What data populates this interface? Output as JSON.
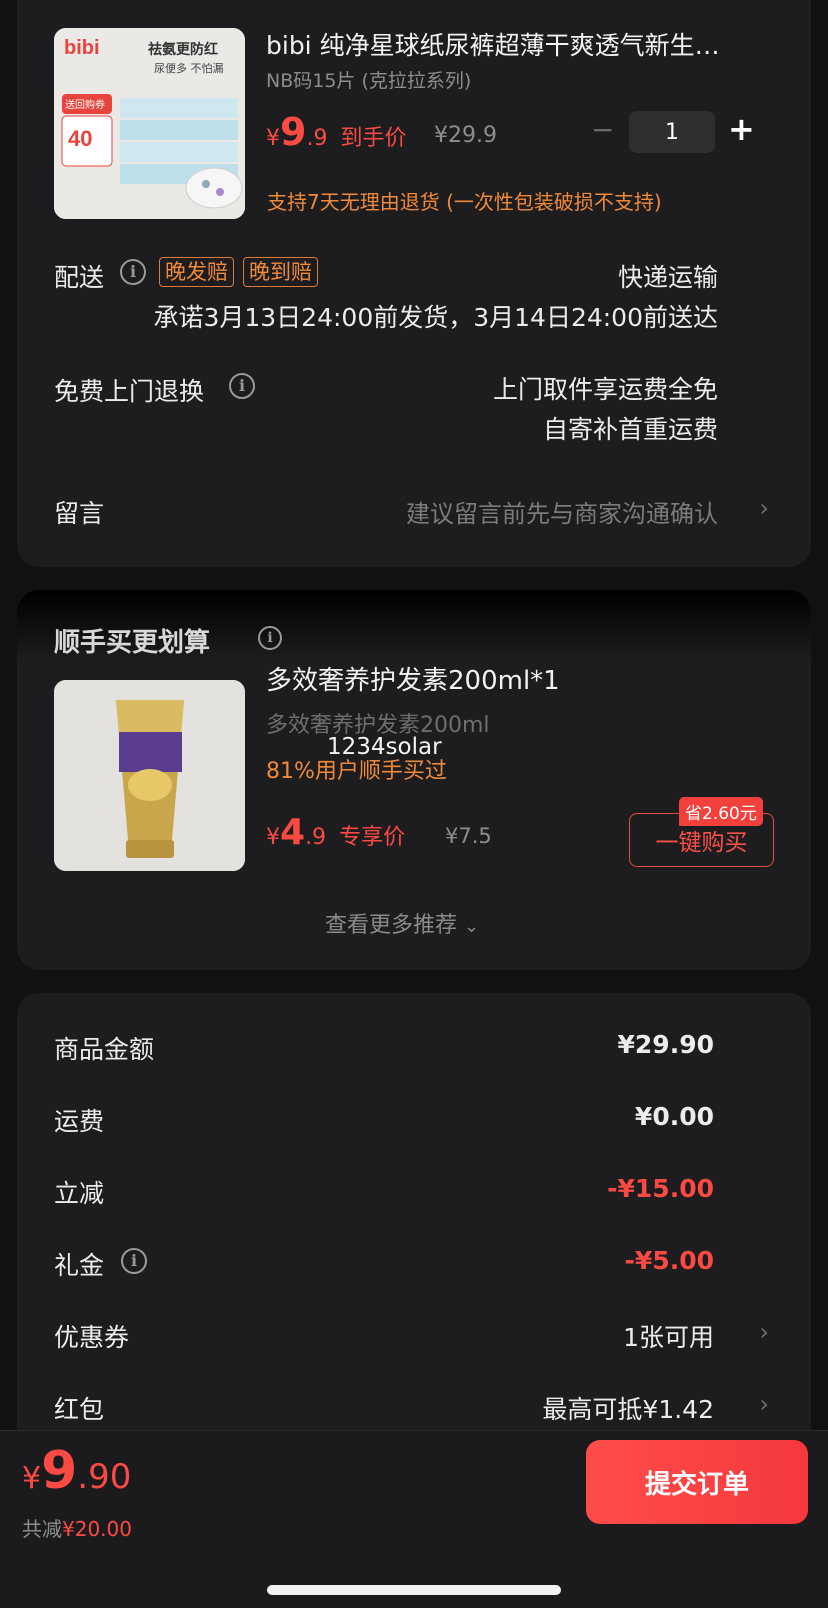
{
  "product": {
    "image_brand": "bibi",
    "image_slogan1": "祛氨更防红",
    "image_slogan2": "尿便多 不怕漏",
    "image_badge": "送回购券",
    "image_coupon": "40",
    "title": "bibi 纯净星球纸尿裤超薄干爽透气新生…",
    "spec": "NB码15片 (克拉拉系列)",
    "price_symbol": "¥",
    "price_int": "9",
    "price_dec": ".9",
    "price_tag": "到手价",
    "original_price": "¥29.9",
    "quantity": "1",
    "minus": "−",
    "plus": "+",
    "return_note": "支持7天无理由退货 (一次性包装破损不支持)"
  },
  "delivery": {
    "label": "配送",
    "tag1": "晚发赔",
    "tag2": "晚到赔",
    "method": "快递运输",
    "promise": "承诺3月13日24:00前发货，3月14日24:00前送达"
  },
  "returns": {
    "label": "免费上门退换",
    "line1": "上门取件享运费全免",
    "line2": "自寄补首重运费"
  },
  "message": {
    "label": "留言",
    "placeholder": "建议留言前先与商家沟通确认"
  },
  "addon": {
    "section_title": "顺手买更划算",
    "title": "多效奢养护发素200ml*1",
    "spec": "多效奢养护发素200ml",
    "overlay_text": "1234solar",
    "social": "81%用户顺手买过",
    "price_symbol": "¥",
    "price_int": "4",
    "price_dec": ".9",
    "price_tag": "专享价",
    "original_price": "¥7.5",
    "save_badge": "省2.60元",
    "buy_button": "一键购买",
    "more": "查看更多推荐"
  },
  "summary": {
    "rows": [
      {
        "label": "商品金额",
        "value": "¥29.90"
      },
      {
        "label": "运费",
        "value": "¥0.00"
      },
      {
        "label": "立减",
        "value": "-¥15.00"
      },
      {
        "label": "礼金",
        "value": "-¥5.00"
      },
      {
        "label": "优惠券",
        "value": "1张可用"
      },
      {
        "label": "红包",
        "value": "最高可抵¥1.42"
      }
    ]
  },
  "bottom": {
    "price_symbol": "¥",
    "price_int": "9",
    "price_dec": ".90",
    "saved_label": "共减",
    "saved_value": "¥20.00",
    "submit": "提交订单"
  },
  "icons": {
    "info": "info-icon",
    "chevron": "chevron-right-icon",
    "chevron_down": "chevron-down-icon"
  },
  "colors": {
    "accent_red": "#fb4a44",
    "accent_orange": "#f08a3a",
    "background": "#111111",
    "card": "#1d1c1e"
  }
}
